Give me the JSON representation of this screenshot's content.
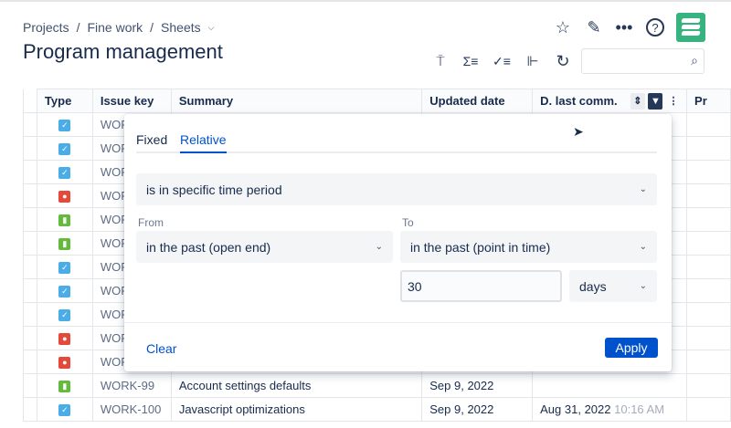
{
  "breadcrumb": [
    "Projects",
    "Fine work",
    "Sheets"
  ],
  "page_title": "Program management",
  "columns": [
    "Type",
    "Issue key",
    "Summary",
    "Updated date",
    "D. last comm.",
    "Pr"
  ],
  "rows": [
    {
      "type": "task",
      "key": "WOR",
      "summary": "",
      "updated": "",
      "last": "",
      "time": ""
    },
    {
      "type": "task",
      "key": "WOR",
      "summary": "",
      "updated": "",
      "last": "",
      "time": ""
    },
    {
      "type": "task",
      "key": "WOR",
      "summary": "",
      "updated": "",
      "last": "",
      "time": ""
    },
    {
      "type": "bug",
      "key": "WOR",
      "summary": "",
      "updated": "",
      "last": "",
      "time": ""
    },
    {
      "type": "story",
      "key": "WOR",
      "summary": "",
      "updated": "",
      "last": "",
      "time": ""
    },
    {
      "type": "story",
      "key": "WOR",
      "summary": "",
      "updated": "",
      "last": "",
      "time": ""
    },
    {
      "type": "task",
      "key": "WOR",
      "summary": "",
      "updated": "",
      "last": "",
      "time": ""
    },
    {
      "type": "task",
      "key": "WOR",
      "summary": "",
      "updated": "",
      "last": "",
      "time": ""
    },
    {
      "type": "task",
      "key": "WOR",
      "summary": "",
      "updated": "",
      "last": "",
      "time": ""
    },
    {
      "type": "bug",
      "key": "WOR",
      "summary": "",
      "updated": "",
      "last": "",
      "time": ""
    },
    {
      "type": "bug",
      "key": "WOR",
      "summary": "",
      "updated": "",
      "last": "",
      "time": ""
    },
    {
      "type": "story",
      "key": "WORK-99",
      "summary": "Account settings defaults",
      "updated": "Sep 9, 2022",
      "last": "",
      "time": ""
    },
    {
      "type": "task",
      "key": "WORK-100",
      "summary": "Javascript optimizations",
      "updated": "Sep 9, 2022",
      "last": "Aug 31, 2022",
      "time": "10:16 AM"
    }
  ],
  "filter": {
    "tabs": [
      "Fixed",
      "Relative"
    ],
    "active_tab": "Relative",
    "condition": "is in specific time period",
    "from_label": "From",
    "to_label": "To",
    "from_value": "in the past (open end)",
    "to_value": "in the past (point in time)",
    "amount": "30",
    "unit": "days",
    "clear": "Clear",
    "apply": "Apply"
  },
  "colors": {
    "accent": "#0052cc",
    "logo": "#36b37e",
    "task": "#4bade8",
    "bug": "#e5493a",
    "story": "#63ba3c"
  }
}
